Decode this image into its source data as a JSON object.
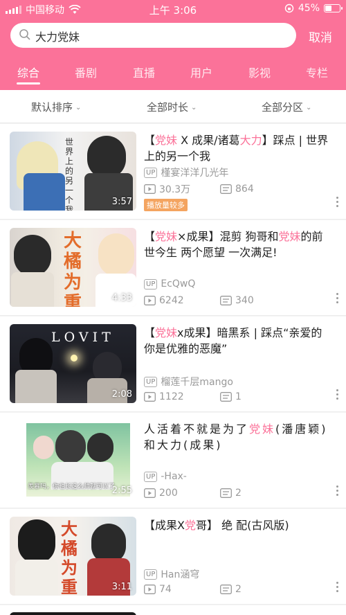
{
  "status_bar": {
    "carrier": "中国移动",
    "time": "上午 3:06",
    "battery": "45%",
    "battery_level": 0.45
  },
  "search": {
    "query": "大力党妹",
    "cancel_label": "取消"
  },
  "tabs": [
    {
      "label": "综合"
    },
    {
      "label": "番剧"
    },
    {
      "label": "直播"
    },
    {
      "label": "用户"
    },
    {
      "label": "影视"
    },
    {
      "label": "专栏"
    }
  ],
  "filters": [
    {
      "label": "默认排序"
    },
    {
      "label": "全部时长"
    },
    {
      "label": "全部分区"
    }
  ],
  "videos": [
    {
      "title": [
        {
          "t": "【"
        },
        {
          "t": "党妹",
          "hl": true
        },
        {
          "t": " X 成果/诸葛"
        },
        {
          "t": "大力",
          "hl": true
        },
        {
          "t": "】踩点 | 世界上的另一个我"
        }
      ],
      "uploader": "槿宴洋洋几光年",
      "views": "30.3万",
      "danmaku": "864",
      "duration": "3:57",
      "tag": "播放量较多",
      "thumb_text": "世界上的另一个我"
    },
    {
      "title": [
        {
          "t": "【"
        },
        {
          "t": "党妹",
          "hl": true
        },
        {
          "t": "×成果】混剪 狗哥和"
        },
        {
          "t": "党妹",
          "hl": true
        },
        {
          "t": "的前世今生 两个愿望 一次满足!"
        }
      ],
      "uploader": "EcQwQ",
      "views": "6242",
      "danmaku": "340",
      "duration": "4:33",
      "thumb_text": "大橘为重"
    },
    {
      "title": [
        {
          "t": "【"
        },
        {
          "t": "党妹",
          "hl": true
        },
        {
          "t": "x成果】暗黑系 | 踩点“亲爱的你是优雅的恶魔”"
        }
      ],
      "uploader": "榴莲千层mango",
      "views": "1122",
      "danmaku": "1",
      "duration": "2:08",
      "thumb_text": "LOVIT"
    },
    {
      "title": [
        {
          "t": "人活着不就是为了"
        },
        {
          "t": "党妹",
          "hl": true
        },
        {
          "t": "(潘唐颖)和大力(成果)"
        }
      ],
      "uploader": "-Hax-",
      "views": "200",
      "danmaku": "2",
      "duration": "2:55",
      "thumb_text": "羡慕吗，你也长这么帅就可以了"
    },
    {
      "title": [
        {
          "t": "【成果X"
        },
        {
          "t": "党",
          "hl": true
        },
        {
          "t": "哥】  绝  配(古风版)"
        }
      ],
      "uploader": "Han涵穹",
      "views": "74",
      "danmaku": "2",
      "duration": "3:11",
      "thumb_text": "大橘为重"
    }
  ],
  "colors": {
    "accent": "#fb7299",
    "tag": "#f4a460"
  }
}
